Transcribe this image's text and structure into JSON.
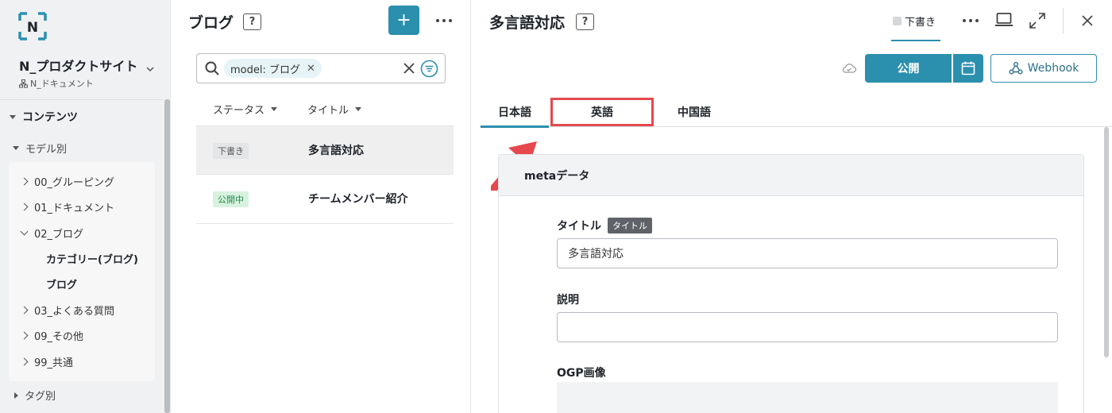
{
  "sidebar": {
    "project_name": "N_プロダクトサイト",
    "project_sub": "N_ドキュメント",
    "contents_label": "コンテンツ",
    "by_model_label": "モデル別",
    "models": [
      {
        "label": "00_グルーピング"
      },
      {
        "label": "01_ドキュメント"
      },
      {
        "label": "02_ブログ"
      },
      {
        "label": "03_よくある質問"
      },
      {
        "label": "09_その他"
      },
      {
        "label": "99_共通"
      }
    ],
    "sub_models": [
      "カテゴリー(ブログ)",
      "ブログ"
    ],
    "by_tag_label": "タグ別"
  },
  "list": {
    "title": "ブログ",
    "add_label": "+",
    "filter_chip": "model: ブログ",
    "columns": [
      "ステータス",
      "タイトル"
    ],
    "rows": [
      {
        "status": "下書き",
        "title": "多言語対応"
      },
      {
        "status": "公開中",
        "title": "チームメンバー紹介"
      }
    ]
  },
  "editor": {
    "title": "多言語対応",
    "status_tab": "下書き",
    "publish_label": "公開",
    "webhook_label": "Webhook",
    "lang_tabs": [
      "日本語",
      "英語",
      "中国語"
    ],
    "active_lang": "日本語",
    "highlighted_lang": "英語",
    "section_title": "metaデータ",
    "fields": {
      "title_label": "タイトル",
      "title_tag": "タイトル",
      "title_value": "多言語対応",
      "desc_label": "説明",
      "desc_value": "",
      "ogp_label": "OGP画像"
    }
  },
  "colors": {
    "accent": "#2b8fae",
    "highlight": "#e5484d"
  }
}
